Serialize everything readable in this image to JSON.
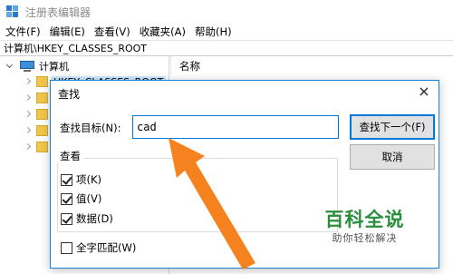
{
  "window": {
    "title": "注册表编辑器"
  },
  "menu": [
    "文件(F)",
    "编辑(E)",
    "查看(V)",
    "收藏夹(A)",
    "帮助(H)"
  ],
  "address": "计算机\\HKEY_CLASSES_ROOT",
  "tree": {
    "root_label": "计算机",
    "selected_label": "HKEY_CLASSES_ROOT"
  },
  "list": {
    "column_name": "名称"
  },
  "find_dialog": {
    "title": "查找",
    "close_label": "×",
    "find_what_label": "查找目标(N):",
    "find_what_value": "cad",
    "find_next_button": "查找下一个(F)",
    "cancel_button": "取消",
    "look_at_group": "查看",
    "options": [
      {
        "label": "项(K)",
        "checked": true
      },
      {
        "label": "值(V)",
        "checked": true
      },
      {
        "label": "数据(D)",
        "checked": true
      }
    ],
    "match_whole": {
      "label": "全字匹配(W)",
      "checked": false
    }
  },
  "annotation": {
    "arrow_color": "#f5821f"
  },
  "watermark": {
    "title": "百科全说",
    "subtitle": "助你轻松解决",
    "color": "#2a8f3d"
  },
  "icons": {
    "app": "registry-editor-icon",
    "computer": "computer-icon",
    "folder": "folder-icon",
    "close": "close-icon",
    "expand": "chevron-right-icon",
    "collapse": "chevron-down-icon",
    "checkbox": "checkbox-icon"
  }
}
